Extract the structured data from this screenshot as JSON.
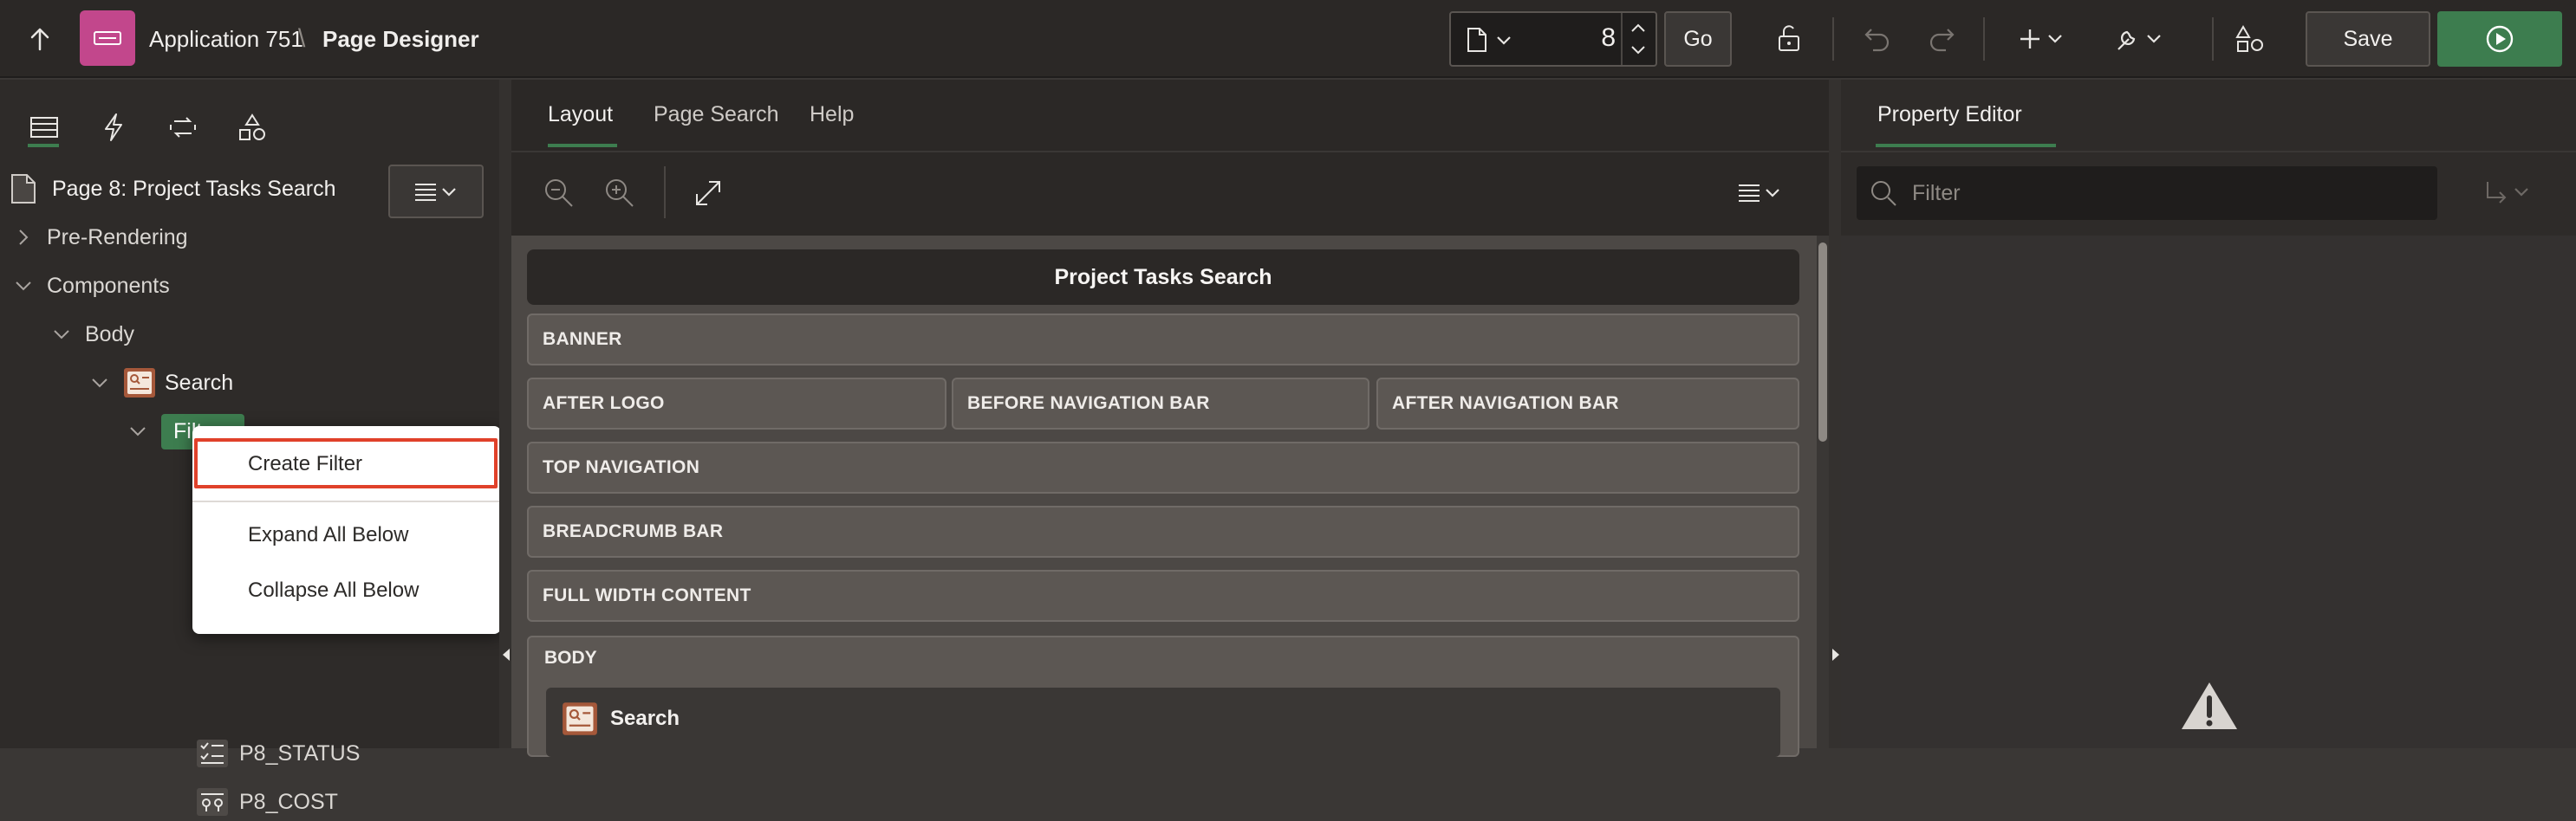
{
  "topbar": {
    "app_name": "Application 751",
    "separator": "\\",
    "page_designer": "Page Designer",
    "page_number": "8",
    "go_label": "Go",
    "save_label": "Save"
  },
  "left_panel": {
    "page_title": "Page 8: Project Tasks Search",
    "tree": {
      "pre_rendering": "Pre-Rendering",
      "components": "Components",
      "body": "Body",
      "search": "Search",
      "filters": "Filters",
      "p8_status": "P8_STATUS",
      "p8_cost": "P8_COST"
    }
  },
  "context_menu": {
    "items": [
      "Create Filter",
      "Expand All Below",
      "Collapse All Below"
    ]
  },
  "center": {
    "tabs": [
      "Layout",
      "Page Search",
      "Help"
    ],
    "page_header": "Project Tasks Search",
    "regions": {
      "banner": "BANNER",
      "after_logo": "AFTER LOGO",
      "before_nav": "BEFORE NAVIGATION BAR",
      "after_nav": "AFTER NAVIGATION BAR",
      "top_nav": "TOP NAVIGATION",
      "breadcrumb": "BREADCRUMB BAR",
      "full_width": "FULL WIDTH CONTENT",
      "body": "BODY",
      "search": "Search"
    }
  },
  "right_panel": {
    "tab": "Property Editor",
    "filter_placeholder": "Filter"
  },
  "colors": {
    "accent_green": "#3d7d4f",
    "app_icon": "#c2478c",
    "highlight_red": "#e0412a"
  }
}
